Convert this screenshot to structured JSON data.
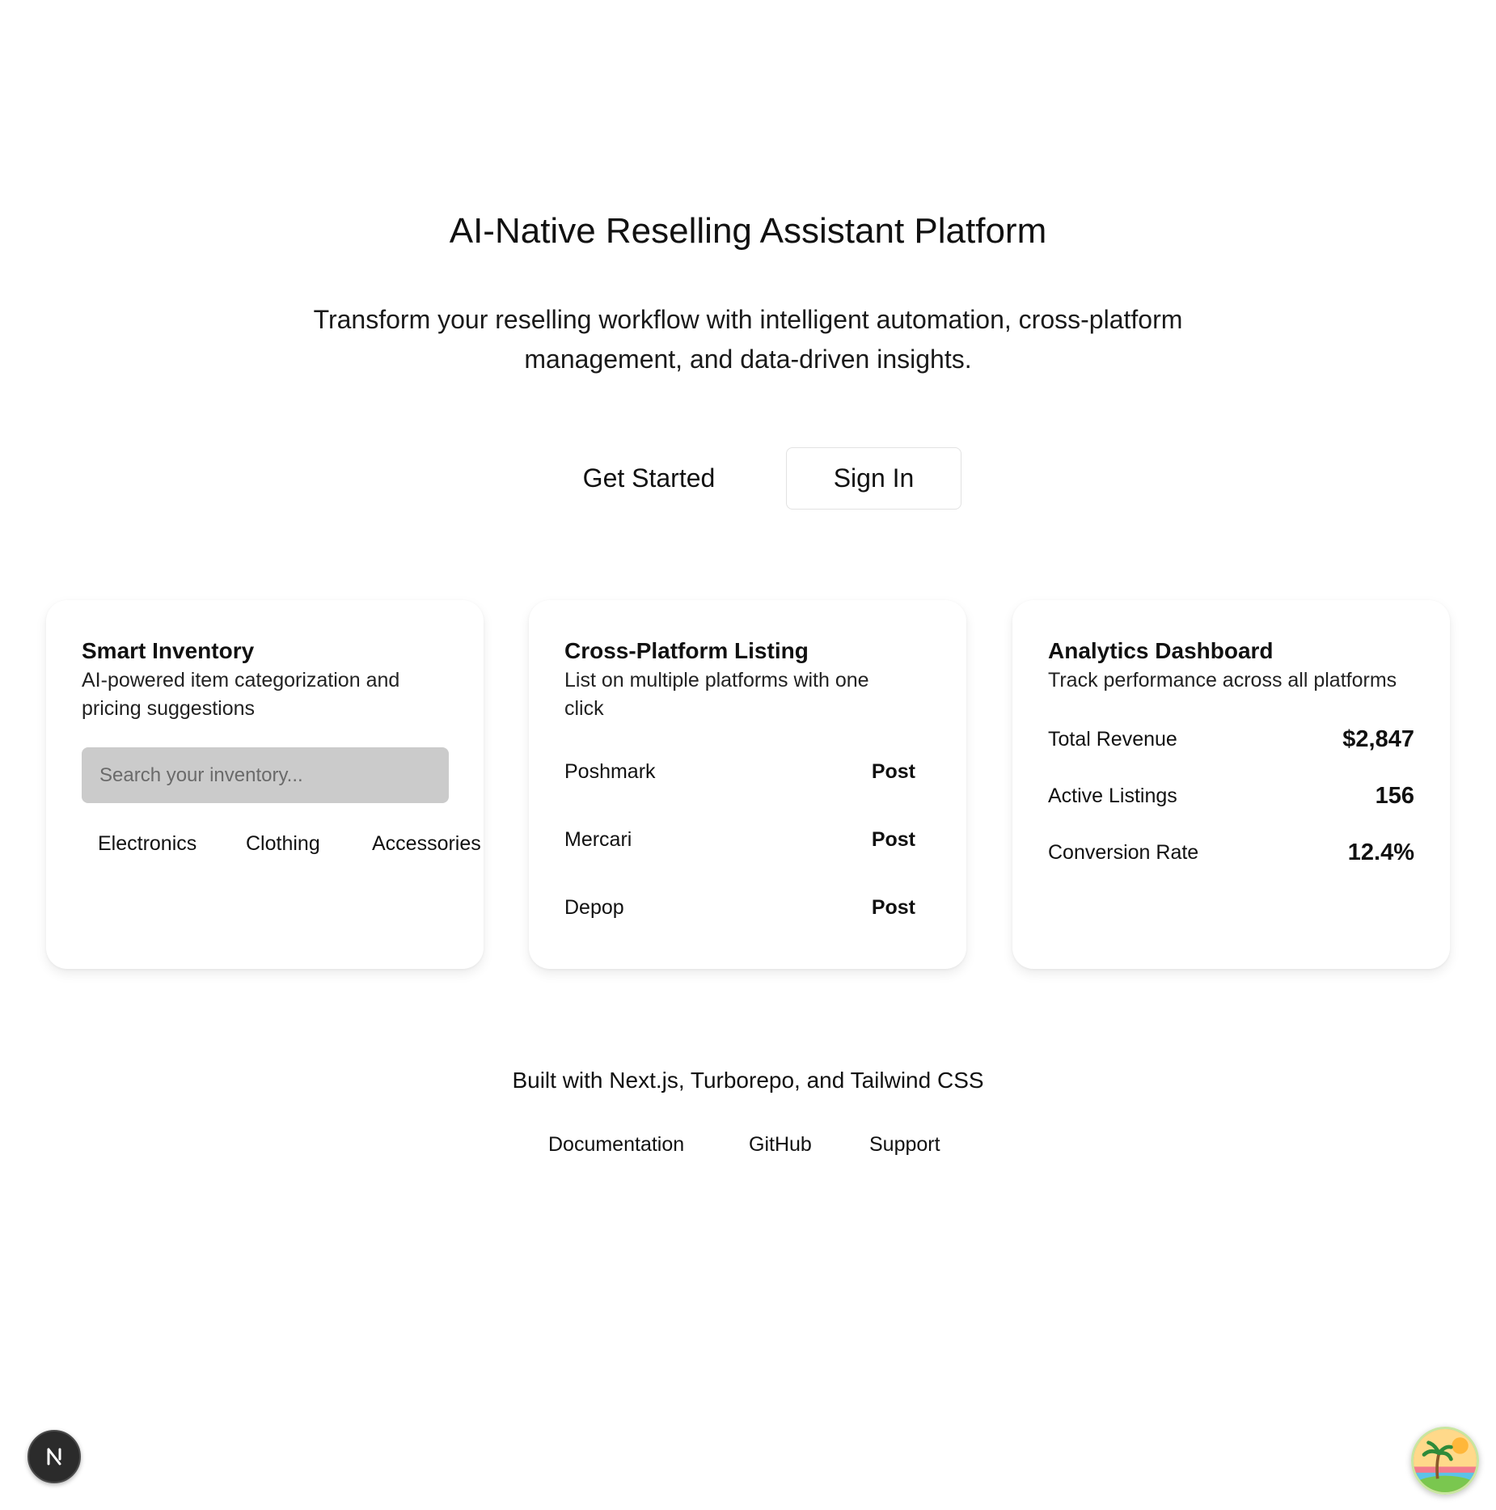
{
  "hero": {
    "title": "AI-Native Reselling Assistant Platform",
    "subtitle_line1": "Transform your reselling workflow with intelligent automation, cross-platform",
    "subtitle_line2": "management, and data-driven insights.",
    "primary_cta": "Get Started",
    "secondary_cta": "Sign In"
  },
  "cards": {
    "inventory": {
      "title": "Smart Inventory",
      "description_line1": "AI-powered item categorization and",
      "description_line2": "pricing suggestions",
      "search_placeholder": "Search your inventory...",
      "categories": [
        "Electronics",
        "Clothing",
        "Accessories"
      ]
    },
    "listing": {
      "title": "Cross-Platform Listing",
      "description_line1": "List on multiple platforms with one",
      "description_line2": "click",
      "platforms": [
        {
          "name": "Poshmark",
          "action": "Post"
        },
        {
          "name": "Mercari",
          "action": "Post"
        },
        {
          "name": "Depop",
          "action": "Post"
        }
      ]
    },
    "analytics": {
      "title": "Analytics Dashboard",
      "description": "Track performance across all platforms",
      "stats": [
        {
          "label": "Total Revenue",
          "value": "$2,847"
        },
        {
          "label": "Active Listings",
          "value": "156"
        },
        {
          "label": "Conversion Rate",
          "value": "12.4%"
        }
      ]
    }
  },
  "footer": {
    "built_with": "Built with Next.js, Turborepo, and Tailwind CSS",
    "links": [
      "Documentation",
      "GitHub",
      "Support"
    ]
  },
  "floating": {
    "next_badge_icon": "nextjs-logo-icon",
    "avatar_icon": "beach-avatar-icon"
  }
}
